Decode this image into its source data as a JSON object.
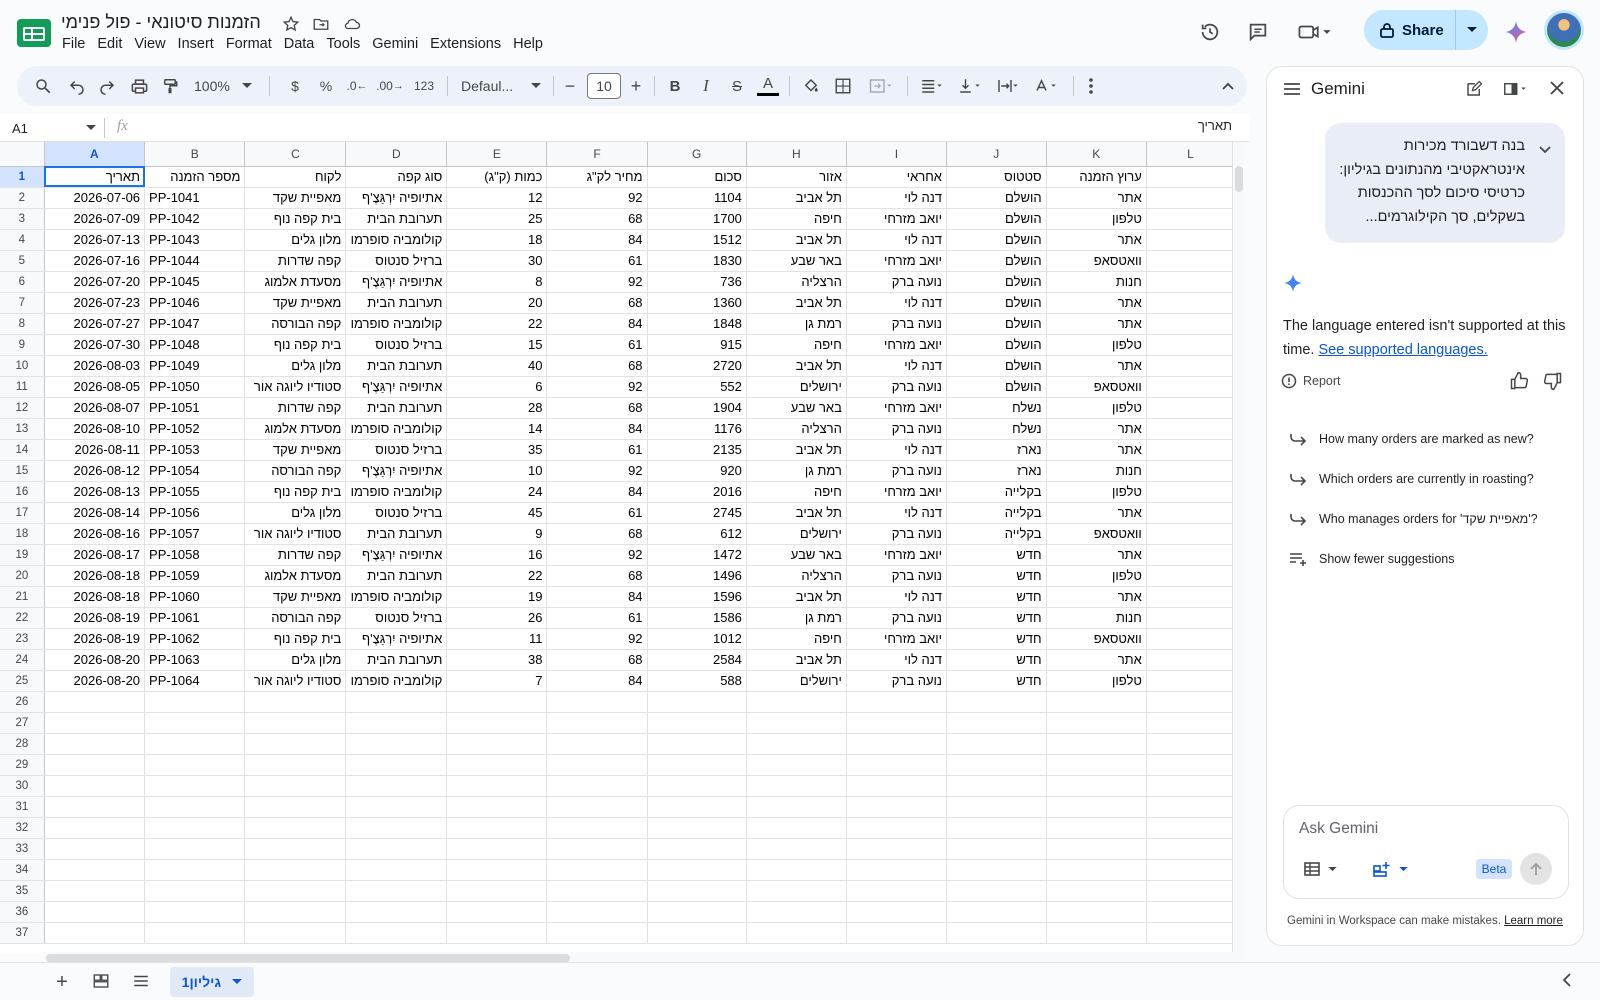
{
  "app": {
    "doc_title": "הזמנות סיטונאי - פול פנימי",
    "menu": [
      "File",
      "Edit",
      "View",
      "Insert",
      "Format",
      "Data",
      "Tools",
      "Gemini",
      "Extensions",
      "Help"
    ],
    "share_label": "Share"
  },
  "toolbar": {
    "zoom": "100%",
    "currency": "$",
    "percent": "%",
    "dec_decrease": ".0",
    "dec_increase": ".00",
    "number_format": "123",
    "font": "Defaul...",
    "font_size": "10",
    "minus": "−",
    "plus": "+"
  },
  "formula_bar": {
    "cell_ref": "A1",
    "fx": "fx",
    "content": "תאריך"
  },
  "grid": {
    "columns": [
      "A",
      "B",
      "C",
      "D",
      "E",
      "F",
      "G",
      "H",
      "I",
      "J",
      "K",
      "L"
    ],
    "header_row": [
      "תאריך",
      "מספר הזמנה",
      "לקוח",
      "סוג קפה",
      "כמות (ק\"ג)",
      "מחיר לק\"ג",
      "סכום",
      "אזור",
      "אחראי",
      "סטטוס",
      "ערוץ הזמנה",
      ""
    ],
    "rows": [
      [
        "2026-07-06",
        "PP-1041",
        "מאפיית שקד",
        "אתיופיה יִרְגַּצֶ'ף",
        "12",
        "92",
        "1104",
        "תל אביב",
        "דנה לוי",
        "הושלם",
        "אתר"
      ],
      [
        "2026-07-09",
        "PP-1042",
        "בית קפה נוף",
        "תערובת הבית",
        "25",
        "68",
        "1700",
        "חיפה",
        "יואב מזרחי",
        "הושלם",
        "טלפון"
      ],
      [
        "2026-07-13",
        "PP-1043",
        "מלון גלים",
        "קולומביה סופרמו",
        "18",
        "84",
        "1512",
        "תל אביב",
        "דנה לוי",
        "הושלם",
        "אתר"
      ],
      [
        "2026-07-16",
        "PP-1044",
        "קפה שדרות",
        "ברזיל סנטוס",
        "30",
        "61",
        "1830",
        "באר שבע",
        "יואב מזרחי",
        "הושלם",
        "וואטסאפ"
      ],
      [
        "2026-07-20",
        "PP-1045",
        "מסעדת אלמוג",
        "אתיופיה יִרְגַּצֶ'ף",
        "8",
        "92",
        "736",
        "הרצליה",
        "נועה ברק",
        "הושלם",
        "חנות"
      ],
      [
        "2026-07-23",
        "PP-1046",
        "מאפיית שקד",
        "תערובת הבית",
        "20",
        "68",
        "1360",
        "תל אביב",
        "דנה לוי",
        "הושלם",
        "אתר"
      ],
      [
        "2026-07-27",
        "PP-1047",
        "קפה הבורסה",
        "קולומביה סופרמו",
        "22",
        "84",
        "1848",
        "רמת גן",
        "נועה ברק",
        "הושלם",
        "אתר"
      ],
      [
        "2026-07-30",
        "PP-1048",
        "בית קפה נוף",
        "ברזיל סנטוס",
        "15",
        "61",
        "915",
        "חיפה",
        "יואב מזרחי",
        "הושלם",
        "טלפון"
      ],
      [
        "2026-08-03",
        "PP-1049",
        "מלון גלים",
        "תערובת הבית",
        "40",
        "68",
        "2720",
        "תל אביב",
        "דנה לוי",
        "הושלם",
        "אתר"
      ],
      [
        "2026-08-05",
        "PP-1050",
        "סטודיו ליוגה אור",
        "אתיופיה יִרְגַּצֶ'ף",
        "6",
        "92",
        "552",
        "ירושלים",
        "נועה ברק",
        "הושלם",
        "וואטסאפ"
      ],
      [
        "2026-08-07",
        "PP-1051",
        "קפה שדרות",
        "תערובת הבית",
        "28",
        "68",
        "1904",
        "באר שבע",
        "יואב מזרחי",
        "נשלח",
        "טלפון"
      ],
      [
        "2026-08-10",
        "PP-1052",
        "מסעדת אלמוג",
        "קולומביה סופרמו",
        "14",
        "84",
        "1176",
        "הרצליה",
        "נועה ברק",
        "נשלח",
        "אתר"
      ],
      [
        "2026-08-11",
        "PP-1053",
        "מאפיית שקד",
        "ברזיל סנטוס",
        "35",
        "61",
        "2135",
        "תל אביב",
        "דנה לוי",
        "נארז",
        "אתר"
      ],
      [
        "2026-08-12",
        "PP-1054",
        "קפה הבורסה",
        "אתיופיה יִרְגַּצֶ'ף",
        "10",
        "92",
        "920",
        "רמת גן",
        "נועה ברק",
        "נארז",
        "חנות"
      ],
      [
        "2026-08-13",
        "PP-1055",
        "בית קפה נוף",
        "קולומביה סופרמו",
        "24",
        "84",
        "2016",
        "חיפה",
        "יואב מזרחי",
        "בקלייה",
        "טלפון"
      ],
      [
        "2026-08-14",
        "PP-1056",
        "מלון גלים",
        "ברזיל סנטוס",
        "45",
        "61",
        "2745",
        "תל אביב",
        "דנה לוי",
        "בקלייה",
        "אתר"
      ],
      [
        "2026-08-16",
        "PP-1057",
        "סטודיו ליוגה אור",
        "תערובת הבית",
        "9",
        "68",
        "612",
        "ירושלים",
        "נועה ברק",
        "בקלייה",
        "וואטסאפ"
      ],
      [
        "2026-08-17",
        "PP-1058",
        "קפה שדרות",
        "אתיופיה יִרְגַּצֶ'ף",
        "16",
        "92",
        "1472",
        "באר שבע",
        "יואב מזרחי",
        "חדש",
        "אתר"
      ],
      [
        "2026-08-18",
        "PP-1059",
        "מסעדת אלמוג",
        "תערובת הבית",
        "22",
        "68",
        "1496",
        "הרצליה",
        "נועה ברק",
        "חדש",
        "טלפון"
      ],
      [
        "2026-08-18",
        "PP-1060",
        "מאפיית שקד",
        "קולומביה סופרמו",
        "19",
        "84",
        "1596",
        "תל אביב",
        "דנה לוי",
        "חדש",
        "אתר"
      ],
      [
        "2026-08-19",
        "PP-1061",
        "קפה הבורסה",
        "ברזיל סנטוס",
        "26",
        "61",
        "1586",
        "רמת גן",
        "נועה ברק",
        "חדש",
        "חנות"
      ],
      [
        "2026-08-19",
        "PP-1062",
        "בית קפה נוף",
        "אתיופיה יִרְגַּצֶ'ף",
        "11",
        "92",
        "1012",
        "חיפה",
        "יואב מזרחי",
        "חדש",
        "וואטסאפ"
      ],
      [
        "2026-08-20",
        "PP-1063",
        "מלון גלים",
        "תערובת הבית",
        "38",
        "68",
        "2584",
        "תל אביב",
        "דנה לוי",
        "חדש",
        "אתר"
      ],
      [
        "2026-08-20",
        "PP-1064",
        "סטודיו ליוגה אור",
        "קולומביה סופרמו",
        "7",
        "84",
        "588",
        "ירושלים",
        "נועה ברק",
        "חדש",
        "טלפון"
      ]
    ],
    "empty_row_numbers": [
      "26",
      "27",
      "28",
      "29",
      "30",
      "31",
      "32",
      "33",
      "34",
      "35",
      "36",
      "37"
    ]
  },
  "sheets": {
    "active_tab": "גיליון1"
  },
  "gemini": {
    "title": "Gemini",
    "user_prompt": "בנה דשבורד מכירות אינטראקטיבי מהנתונים בגיליון: כרטיסי סיכום לסך ההכנסות בשקלים, סך הקילוגרמים...",
    "response_text": "The language entered isn't supported at this time.",
    "response_link": "See supported languages.",
    "report_label": "Report",
    "suggestions": [
      "How many orders are marked as new?",
      "Which orders are currently in roasting?",
      "Who manages orders for 'מאפיית שקד'?"
    ],
    "show_fewer": "Show fewer suggestions",
    "input_placeholder": "Ask Gemini",
    "beta_label": "Beta",
    "disclaimer": "Gemini in Workspace can make mistakes.",
    "learn_more": "Learn more"
  },
  "colors": {
    "accent": "#0b57d0",
    "share_bg": "#c2e7ff",
    "toolbar_bg": "#edf2fa",
    "selection": "#1a73e8",
    "sheets_green": "#0f9d58"
  }
}
